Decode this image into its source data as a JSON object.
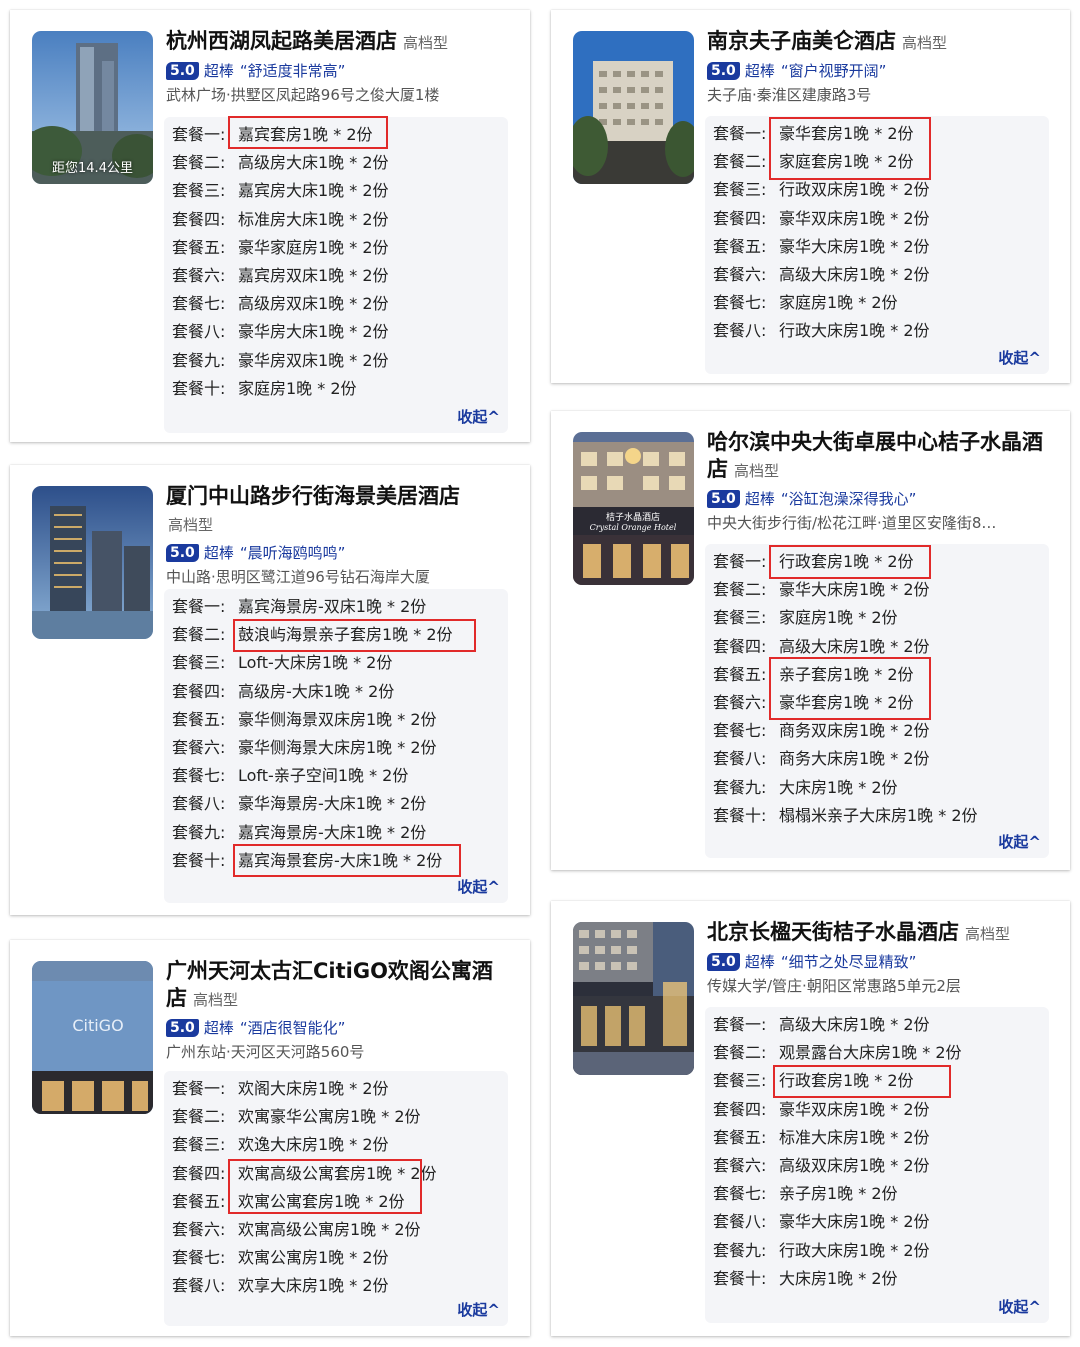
{
  "cards": [
    {
      "title": "杭州西湖凤起路美居酒店",
      "tier": "高档型",
      "score": "5.0",
      "grade": "超棒",
      "quote": "“舒适度非常高”",
      "address": "武林广场·拱墅区凤起路96号之俊大厦1楼",
      "distance": "距您14.4公里",
      "collapse": "收起^",
      "packages": [
        {
          "name": "套餐一:",
          "room": "嘉宾套房1晚 * 2份"
        },
        {
          "name": "套餐二:",
          "room": "高级房大床1晚 * 2份"
        },
        {
          "name": "套餐三:",
          "room": "嘉宾房大床1晚 * 2份"
        },
        {
          "name": "套餐四:",
          "room": "标准房大床1晚 * 2份"
        },
        {
          "name": "套餐五:",
          "room": "豪华家庭房1晚 * 2份"
        },
        {
          "name": "套餐六:",
          "room": "嘉宾房双床1晚 * 2份"
        },
        {
          "name": "套餐七:",
          "room": "高级房双床1晚 * 2份"
        },
        {
          "name": "套餐八:",
          "room": "豪华房大床1晚 * 2份"
        },
        {
          "name": "套餐九:",
          "room": "豪华房双床1晚 * 2份"
        },
        {
          "name": "套餐十:",
          "room": "家庭房1晚 * 2份"
        }
      ]
    },
    {
      "title": "南京夫子庙美仑酒店",
      "tier": "高档型",
      "score": "5.0",
      "grade": "超棒",
      "quote": "“窗户视野开阔”",
      "address": "夫子庙·秦淮区建康路3号",
      "collapse": "收起^",
      "packages": [
        {
          "name": "套餐一:",
          "room": "豪华套房1晚 * 2份"
        },
        {
          "name": "套餐二:",
          "room": "家庭套房1晚 * 2份"
        },
        {
          "name": "套餐三:",
          "room": "行政双床房1晚 * 2份"
        },
        {
          "name": "套餐四:",
          "room": "豪华双床房1晚 * 2份"
        },
        {
          "name": "套餐五:",
          "room": "豪华大床房1晚 * 2份"
        },
        {
          "name": "套餐六:",
          "room": "高级大床房1晚 * 2份"
        },
        {
          "name": "套餐七:",
          "room": "家庭房1晚 * 2份"
        },
        {
          "name": "套餐八:",
          "room": "行政大床房1晚 * 2份"
        }
      ]
    },
    {
      "title": "哈尔滨中央大街卓展中心桔子水晶酒店",
      "tier": "高档型",
      "score": "5.0",
      "grade": "超棒",
      "quote": "“浴缸泡澡深得我心”",
      "address": "中央大街步行街/松花江畔·道里区安隆街8…",
      "sign_text": "桔子水晶酒店",
      "sign_text_en": "Crystal Orange Hotel",
      "collapse": "收起^",
      "packages": [
        {
          "name": "套餐一:",
          "room": "行政套房1晚 * 2份"
        },
        {
          "name": "套餐二:",
          "room": "豪华大床房1晚 * 2份"
        },
        {
          "name": "套餐三:",
          "room": "家庭房1晚 * 2份"
        },
        {
          "name": "套餐四:",
          "room": "高级大床房1晚 * 2份"
        },
        {
          "name": "套餐五:",
          "room": "亲子套房1晚 * 2份"
        },
        {
          "name": "套餐六:",
          "room": "豪华套房1晚 * 2份"
        },
        {
          "name": "套餐七:",
          "room": "商务双床房1晚 * 2份"
        },
        {
          "name": "套餐八:",
          "room": "商务大床房1晚 * 2份"
        },
        {
          "name": "套餐九:",
          "room": "大床房1晚 * 2份"
        },
        {
          "name": "套餐十:",
          "room": "榻榻米亲子大床房1晚 * 2份"
        }
      ]
    },
    {
      "title": "厦门中山路步行街海景美居酒店",
      "tier": "高档型",
      "score": "5.0",
      "grade": "超棒",
      "quote": "“晨听海鸥鸣鸣”",
      "address": "中山路·思明区鹭江道96号钻石海岸大厦",
      "collapse": "收起^",
      "packages": [
        {
          "name": "套餐一:",
          "room": "嘉宾海景房-双床1晚 * 2份"
        },
        {
          "name": "套餐二:",
          "room": "鼓浪屿海景亲子套房1晚 * 2份"
        },
        {
          "name": "套餐三:",
          "room": "Loft-大床房1晚 * 2份"
        },
        {
          "name": "套餐四:",
          "room": "高级房-大床1晚 * 2份"
        },
        {
          "name": "套餐五:",
          "room": "豪华侧海景双床房1晚 * 2份"
        },
        {
          "name": "套餐六:",
          "room": "豪华侧海景大床房1晚 * 2份"
        },
        {
          "name": "套餐七:",
          "room": "Loft-亲子空间1晚 * 2份"
        },
        {
          "name": "套餐八:",
          "room": "豪华海景房-大床1晚 * 2份"
        },
        {
          "name": "套餐九:",
          "room": "嘉宾海景房-大床1晚 * 2份"
        },
        {
          "name": "套餐十:",
          "room": "嘉宾海景套房-大床1晚 * 2份"
        }
      ]
    },
    {
      "title": "北京长楹天街桔子水晶酒店",
      "tier": "高档型",
      "score": "5.0",
      "grade": "超棒",
      "quote": "“细节之处尽显精致”",
      "address": "传媒大学/管庄·朝阳区常惠路5单元2层",
      "collapse": "收起^",
      "packages": [
        {
          "name": "套餐一:",
          "room": "高级大床房1晚 * 2份"
        },
        {
          "name": "套餐二:",
          "room": "观景露台大床房1晚 * 2份"
        },
        {
          "name": "套餐三:",
          "room": "行政套房1晚 * 2份"
        },
        {
          "name": "套餐四:",
          "room": "豪华双床房1晚 * 2份"
        },
        {
          "name": "套餐五:",
          "room": "标准大床房1晚 * 2份"
        },
        {
          "name": "套餐六:",
          "room": "高级双床房1晚 * 2份"
        },
        {
          "name": "套餐七:",
          "room": "亲子房1晚 * 2份"
        },
        {
          "name": "套餐八:",
          "room": "豪华大床房1晚 * 2份"
        },
        {
          "name": "套餐九:",
          "room": "行政大床房1晚 * 2份"
        },
        {
          "name": "套餐十:",
          "room": "大床房1晚 * 2份"
        }
      ]
    },
    {
      "title": "广州天河太古汇CitiGO欢阁公寓酒店",
      "tier": "高档型",
      "score": "5.0",
      "grade": "超棒",
      "quote": "“酒店很智能化”",
      "address": "广州东站·天河区天河路560号",
      "sign_text": "CitiGO",
      "collapse": "收起^",
      "packages": [
        {
          "name": "套餐一:",
          "room": "欢阁大床房1晚 * 2份"
        },
        {
          "name": "套餐二:",
          "room": "欢寓豪华公寓房1晚 * 2份"
        },
        {
          "name": "套餐三:",
          "room": "欢逸大床房1晚 * 2份"
        },
        {
          "name": "套餐四:",
          "room": "欢寓高级公寓套房1晚 * 2份"
        },
        {
          "name": "套餐五:",
          "room": "欢寓公寓套房1晚 * 2份"
        },
        {
          "name": "套餐六:",
          "room": "欢寓高级公寓房1晚 * 2份"
        },
        {
          "name": "套餐七:",
          "room": "欢寓公寓房1晚 * 2份"
        },
        {
          "name": "套餐八:",
          "room": "欢享大床房1晚 * 2份"
        }
      ]
    }
  ],
  "colors": {
    "accent": "#1a3a9e",
    "highlight": "#e12a2a",
    "panel": "#f4f5f8"
  }
}
